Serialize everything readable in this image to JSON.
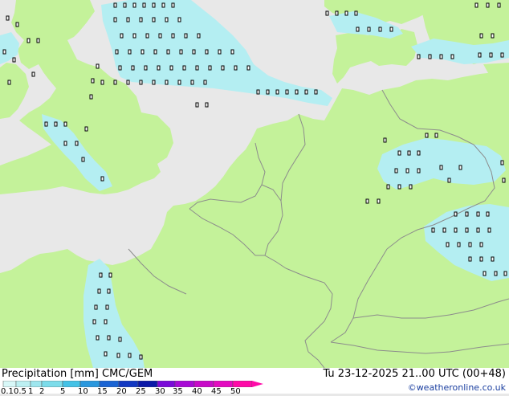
{
  "title": "Precipitation [mm]",
  "model": "CMC/GEM",
  "valid_time": "Tu 23-12-2025 21..00 UTC (00+48)",
  "credit": "©weatheronline.co.uk",
  "legend": {
    "labels": [
      "0.1",
      "0.5",
      "1",
      "2",
      "5",
      "10",
      "15",
      "20",
      "25",
      "30",
      "35",
      "40",
      "45",
      "50"
    ],
    "colors": [
      "#d8f8f8",
      "#bcf0f2",
      "#9ee6ee",
      "#7cdcea",
      "#44c2e6",
      "#2a98de",
      "#1a64d4",
      "#1238c2",
      "#0a18a8",
      "#7a0ad8",
      "#a80ad6",
      "#c80ac8",
      "#e40ac0",
      "#ff0aa8"
    ]
  },
  "colors": {
    "sea": "#e8e8e8",
    "land": "#c4f29a",
    "precip_light": "#b4eef2",
    "border": "#8c8c8c"
  }
}
